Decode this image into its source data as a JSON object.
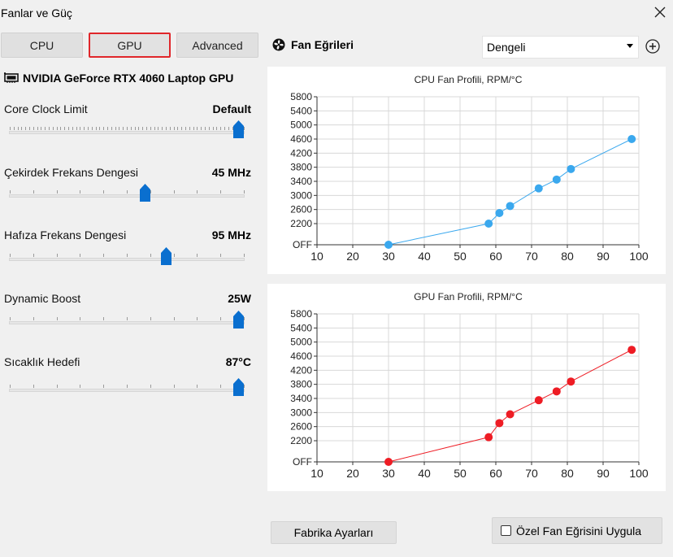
{
  "window": {
    "title": "Fanlar ve Güç"
  },
  "tabs": [
    {
      "label": "CPU",
      "active": false
    },
    {
      "label": "GPU",
      "active": true
    },
    {
      "label": "Advanced",
      "active": false
    }
  ],
  "fan_section": {
    "title": "Fan Eğrileri",
    "profile_select": "Dengeli",
    "icon": "fan-icon"
  },
  "gpu": {
    "name": "NVIDIA GeForce RTX 4060 Laptop GPU",
    "settings": [
      {
        "label": "Core Clock Limit",
        "value": "Default",
        "level": 1.0
      },
      {
        "label": "Çekirdek Frekans Dengesi",
        "value": "45 MHz",
        "level": 0.585
      },
      {
        "label": "Hafıza Frekans Dengesi",
        "value": "95 MHz",
        "level": 0.68
      },
      {
        "label": "Dynamic Boost",
        "value": "25W",
        "level": 1.0
      },
      {
        "label": "Sıcaklık Hedefi",
        "value": "87°C",
        "level": 1.0
      }
    ]
  },
  "colors": {
    "active_tab_border": "#e0272b",
    "cpu_series": "#3aa8ee",
    "gpu_series": "#ee1c24",
    "slider_thumb": "#0a6fcf"
  },
  "buttons": {
    "factory_reset": "Fabrika Ayarları",
    "apply_custom_curve": "Özel Fan Eğrisini Uygula",
    "apply_checked": false
  },
  "chart_data": [
    {
      "type": "line",
      "title": "CPU Fan Profili, RPM/°C",
      "x": [
        30,
        58,
        61,
        64,
        72,
        77,
        81,
        98
      ],
      "y": [
        0,
        2200,
        2500,
        2700,
        3200,
        3450,
        3750,
        4600
      ],
      "xlim": [
        10,
        100
      ],
      "ylim": [
        1600,
        5800
      ],
      "x_ticks": [
        "10",
        "20",
        "30",
        "40",
        "50",
        "60",
        "70",
        "80",
        "90",
        "100"
      ],
      "y_ticks": [
        "OFF",
        "2200",
        "2600",
        "3000",
        "3400",
        "3800",
        "4200",
        "4600",
        "5000",
        "5400",
        "5800"
      ],
      "grid": true,
      "color": "#3aa8ee"
    },
    {
      "type": "line",
      "title": "GPU Fan Profili, RPM/°C",
      "x": [
        30,
        58,
        61,
        64,
        72,
        77,
        81,
        98
      ],
      "y": [
        0,
        2300,
        2700,
        2950,
        3350,
        3600,
        3880,
        4780
      ],
      "xlim": [
        10,
        100
      ],
      "ylim": [
        1600,
        5800
      ],
      "x_ticks": [
        "10",
        "20",
        "30",
        "40",
        "50",
        "60",
        "70",
        "80",
        "90",
        "100"
      ],
      "y_ticks": [
        "OFF",
        "2200",
        "2600",
        "3000",
        "3400",
        "3800",
        "4200",
        "4600",
        "5000",
        "5400",
        "5800"
      ],
      "grid": true,
      "color": "#ee1c24"
    }
  ]
}
